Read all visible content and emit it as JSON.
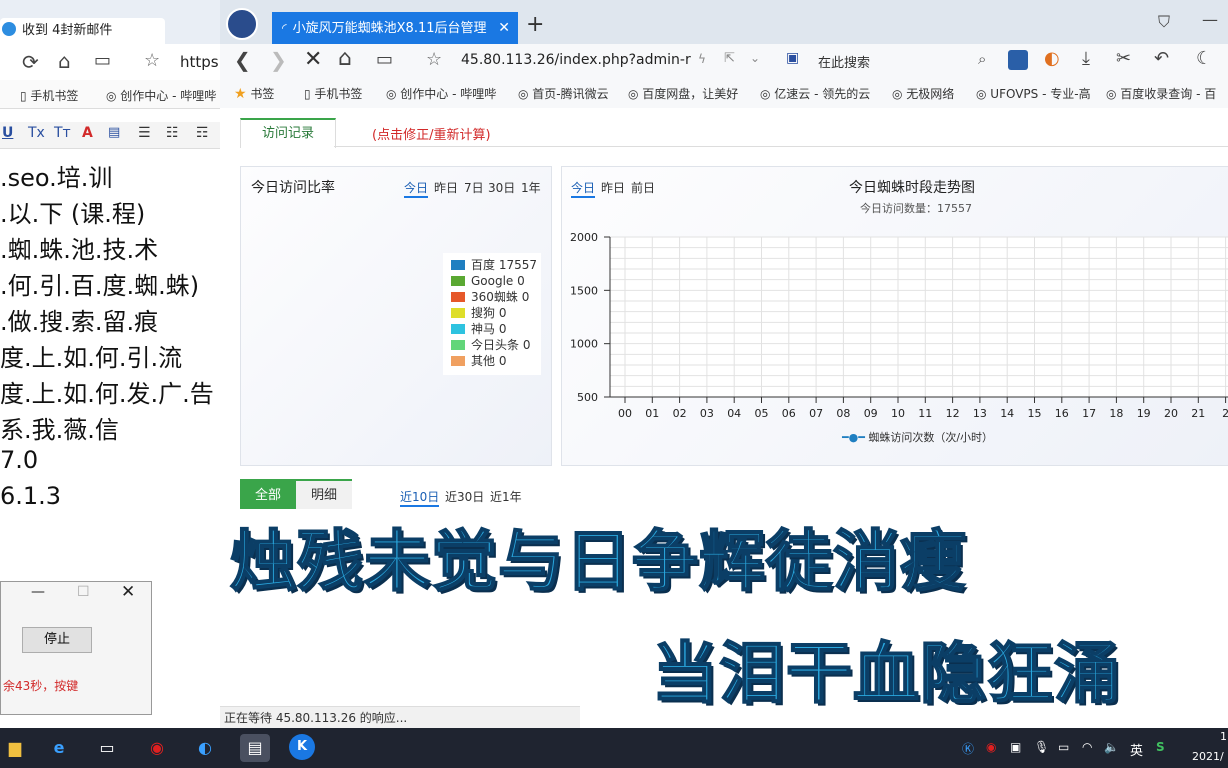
{
  "left_window": {
    "tab_title": "收到 4封新邮件",
    "url_fragment": "https:/",
    "bookmarks": [
      "手机书签",
      "创作中心 - 哔哩哔"
    ],
    "text_lines": [
      ".seo.培.训",
      ".以.下 (课.程)",
      ".蜘.蛛.池.技.术",
      ".何.引.百.度.蜘.蛛)",
      ".做.搜.索.留.痕",
      "度.上.如.何.引.流",
      "度.上.如.何.发.广.告",
      "系.我.薇.信",
      "7.0",
      "6.1.3"
    ],
    "dialog": {
      "button_label": "停止",
      "countdown_text": "余43秒，按键"
    }
  },
  "browser": {
    "tab_title": "小旋风万能蜘蛛池X8.11后台管理",
    "url": "45.80.113.26/index.php?admin-r",
    "search_placeholder": "在此搜索",
    "bookmarks": [
      "书签",
      "手机书签",
      "创作中心 - 哔哩哔",
      "首页-腾讯微云",
      "百度网盘，让美好",
      "亿速云 - 领先的云",
      "无极网络",
      "UFOVPS - 专业-高",
      "百度收录查询 - 百"
    ],
    "status_text": "正在等待 45.80.113.26 的响应..."
  },
  "page": {
    "tabs": {
      "visit_log": "访问记录",
      "recalc": "(点击修正/重新计算)"
    },
    "ratio_panel": {
      "title": "今日访问比率",
      "ranges": [
        "今日",
        "昨日",
        "7日",
        "30日",
        "1年"
      ],
      "legend": [
        {
          "label": "百度 17557",
          "color": "#1f7fc1"
        },
        {
          "label": "Google 0",
          "color": "#5aa832"
        },
        {
          "label": "360蜘蛛 0",
          "color": "#e6582a"
        },
        {
          "label": "搜狗 0",
          "color": "#dede2a"
        },
        {
          "label": "神马 0",
          "color": "#2ec3e0"
        },
        {
          "label": "今日头条 0",
          "color": "#62d67a"
        },
        {
          "label": "其他 0",
          "color": "#f0a060"
        }
      ]
    },
    "trend_panel": {
      "ranges": [
        "今日",
        "昨日",
        "前日"
      ],
      "title": "今日蜘蛛时段走势图",
      "subtitle": "今日访问数量：17557",
      "legend_label": "蜘蛛访问次数（次/小时）"
    },
    "bottom_tabs": [
      "全部",
      "明细"
    ],
    "bottom_ranges": [
      "近10日",
      "近30日",
      "近1年"
    ]
  },
  "chart_data": {
    "type": "line",
    "title": "今日蜘蛛时段走势图",
    "subtitle": "今日访问数量：17557",
    "categories": [
      "00",
      "01",
      "02",
      "03",
      "04",
      "05",
      "06",
      "07",
      "08",
      "09",
      "10",
      "11",
      "12",
      "13",
      "14",
      "15",
      "16",
      "17",
      "18",
      "19",
      "20",
      "21",
      "2"
    ],
    "y_ticks": [
      2000,
      1500,
      1000,
      500
    ],
    "ylim": [
      500,
      2000
    ],
    "series": [
      {
        "name": "蜘蛛访问次数（次/小时）",
        "values": []
      }
    ],
    "grid": true,
    "legend_placement": "bottom"
  },
  "captions": {
    "line1": "烛残未觉与日争辉徒消瘦",
    "line2": "当泪干血隐狂涌"
  },
  "taskbar": {
    "tray_lang": "英",
    "clock_date": "2021/",
    "clock_time": "1"
  },
  "colors": {
    "accent": "#1a78e3",
    "tab_green": "#3aa54a",
    "red_text": "#d22a2a"
  }
}
